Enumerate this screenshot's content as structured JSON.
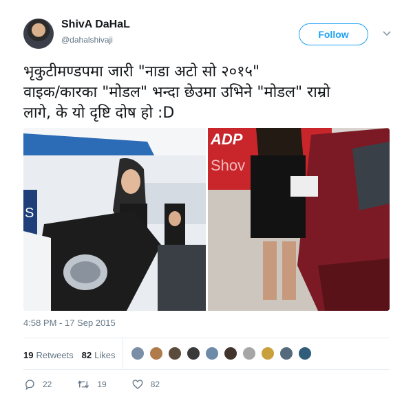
{
  "author": {
    "name": "ShivA DaHaL",
    "handle": "@dahalshivaji"
  },
  "follow_button": {
    "label": "Follow"
  },
  "tweet": {
    "text": "भृकुटीमण्डपमा जारी \"नाडा अटो सो २०१५\"\nवाइक/कारका \"मोडल\" भन्दा छेउमा उभिने \"मोडल\" राम्रो\nलागे, के यो दृष्टि दोष हो :D",
    "timestamp": "4:58 PM - 17 Sep 2015"
  },
  "media": {
    "left_banner_text": "S",
    "right_banner_text": "ADP",
    "right_banner_sub": "Shov"
  },
  "stats": {
    "retweets_count": "19",
    "retweets_label": "Retweets",
    "likes_count": "82",
    "likes_label": "Likes"
  },
  "likers": [
    "#7a8fa6",
    "#b07b4a",
    "#5a4b3c",
    "#3a3a3a",
    "#6d8aa8",
    "#40342c",
    "#a6a6a6",
    "#c9a13c",
    "#556b7d",
    "#2f5d7a"
  ],
  "actions": {
    "reply_count": "22",
    "retweet_count": "19",
    "like_count": "82"
  },
  "colors": {
    "accent": "#1da1f2",
    "secondary_text": "#657786"
  }
}
